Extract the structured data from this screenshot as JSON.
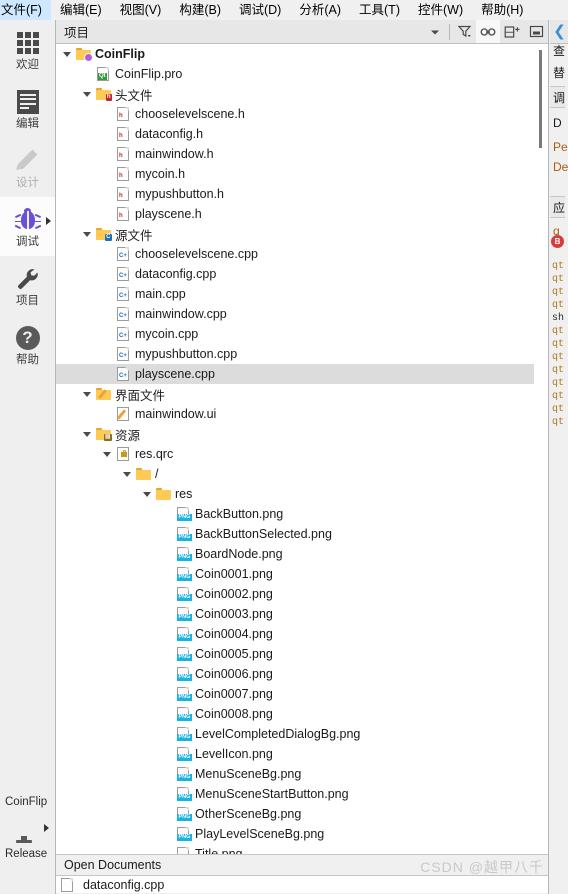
{
  "menubar": {
    "items": [
      {
        "label": "文件(F)",
        "name": "menu-file"
      },
      {
        "label": "编辑(E)",
        "name": "menu-edit"
      },
      {
        "label": "视图(V)",
        "name": "menu-view"
      },
      {
        "label": "构建(B)",
        "name": "menu-build"
      },
      {
        "label": "调试(D)",
        "name": "menu-debug"
      },
      {
        "label": "分析(A)",
        "name": "menu-analyze"
      },
      {
        "label": "工具(T)",
        "name": "menu-tools"
      },
      {
        "label": "控件(W)",
        "name": "menu-window"
      },
      {
        "label": "帮助(H)",
        "name": "menu-help"
      }
    ]
  },
  "modebar": {
    "modes": [
      {
        "label": "欢迎",
        "icon": "grid-icon",
        "state": "normal"
      },
      {
        "label": "编辑",
        "icon": "document-icon",
        "state": "normal"
      },
      {
        "label": "设计",
        "icon": "pencil-icon",
        "state": "disabled"
      },
      {
        "label": "调试",
        "icon": "bug-icon",
        "state": "selected"
      },
      {
        "label": "项目",
        "icon": "wrench-icon",
        "state": "normal"
      },
      {
        "label": "帮助",
        "icon": "question-mark-icon",
        "state": "normal"
      }
    ]
  },
  "kit_selector": {
    "project_name": "CoinFlip",
    "kit_icon": "desktop-monitor-icon",
    "build_config": "Release"
  },
  "nav_header": {
    "title": "项目",
    "buttons": [
      {
        "name": "view-dropdown-button",
        "icon": "chevron-down-icon",
        "active": false
      },
      {
        "name": "filter-button",
        "icon": "filter-funnel-icon",
        "active": false
      },
      {
        "name": "sync-with-editor-button",
        "icon": "link-chain-icon",
        "active": true
      },
      {
        "name": "split-view-button",
        "icon": "split-add-icon",
        "active": false
      },
      {
        "name": "close-pane-button",
        "icon": "minimize-pane-icon",
        "active": false
      }
    ]
  },
  "tree": [
    {
      "label": "CoinFlip",
      "depth": 0,
      "icon": "project-folder-icon",
      "expander": "expanded",
      "bold": true,
      "selected": false
    },
    {
      "label": "CoinFlip.pro",
      "depth": 1,
      "icon": "qt-pro-file-icon",
      "expander": "none",
      "bold": false,
      "selected": false
    },
    {
      "label": "头文件",
      "depth": 1,
      "icon": "header-folder-icon",
      "expander": "expanded",
      "bold": false,
      "selected": false
    },
    {
      "label": "chooselevelscene.h",
      "depth": 2,
      "icon": "header-file-icon",
      "expander": "none",
      "bold": false,
      "selected": false
    },
    {
      "label": "dataconfig.h",
      "depth": 2,
      "icon": "header-file-icon",
      "expander": "none",
      "bold": false,
      "selected": false
    },
    {
      "label": "mainwindow.h",
      "depth": 2,
      "icon": "header-file-icon",
      "expander": "none",
      "bold": false,
      "selected": false
    },
    {
      "label": "mycoin.h",
      "depth": 2,
      "icon": "header-file-icon",
      "expander": "none",
      "bold": false,
      "selected": false
    },
    {
      "label": "mypushbutton.h",
      "depth": 2,
      "icon": "header-file-icon",
      "expander": "none",
      "bold": false,
      "selected": false
    },
    {
      "label": "playscene.h",
      "depth": 2,
      "icon": "header-file-icon",
      "expander": "none",
      "bold": false,
      "selected": false
    },
    {
      "label": "源文件",
      "depth": 1,
      "icon": "source-folder-icon",
      "expander": "expanded",
      "bold": false,
      "selected": false
    },
    {
      "label": "chooselevelscene.cpp",
      "depth": 2,
      "icon": "cpp-file-icon",
      "expander": "none",
      "bold": false,
      "selected": false
    },
    {
      "label": "dataconfig.cpp",
      "depth": 2,
      "icon": "cpp-file-icon",
      "expander": "none",
      "bold": false,
      "selected": false
    },
    {
      "label": "main.cpp",
      "depth": 2,
      "icon": "cpp-file-icon",
      "expander": "none",
      "bold": false,
      "selected": false
    },
    {
      "label": "mainwindow.cpp",
      "depth": 2,
      "icon": "cpp-file-icon",
      "expander": "none",
      "bold": false,
      "selected": false
    },
    {
      "label": "mycoin.cpp",
      "depth": 2,
      "icon": "cpp-file-icon",
      "expander": "none",
      "bold": false,
      "selected": false
    },
    {
      "label": "mypushbutton.cpp",
      "depth": 2,
      "icon": "cpp-file-icon",
      "expander": "none",
      "bold": false,
      "selected": false
    },
    {
      "label": "playscene.cpp",
      "depth": 2,
      "icon": "cpp-file-icon",
      "expander": "none",
      "bold": false,
      "selected": true
    },
    {
      "label": "界面文件",
      "depth": 1,
      "icon": "ui-folder-icon",
      "expander": "expanded",
      "bold": false,
      "selected": false
    },
    {
      "label": "mainwindow.ui",
      "depth": 2,
      "icon": "ui-file-icon",
      "expander": "none",
      "bold": false,
      "selected": false
    },
    {
      "label": "资源",
      "depth": 1,
      "icon": "resource-folder-icon",
      "expander": "expanded",
      "bold": false,
      "selected": false
    },
    {
      "label": "res.qrc",
      "depth": 2,
      "icon": "qrc-file-icon",
      "expander": "expanded",
      "bold": false,
      "selected": false
    },
    {
      "label": "/",
      "depth": 3,
      "icon": "plain-folder-icon",
      "expander": "expanded",
      "bold": false,
      "selected": false
    },
    {
      "label": "res",
      "depth": 4,
      "icon": "plain-folder-icon",
      "expander": "expanded",
      "bold": false,
      "selected": false
    },
    {
      "label": "BackButton.png",
      "depth": 5,
      "icon": "png-file-icon",
      "expander": "none",
      "bold": false,
      "selected": false
    },
    {
      "label": "BackButtonSelected.png",
      "depth": 5,
      "icon": "png-file-icon",
      "expander": "none",
      "bold": false,
      "selected": false
    },
    {
      "label": "BoardNode.png",
      "depth": 5,
      "icon": "png-file-icon",
      "expander": "none",
      "bold": false,
      "selected": false
    },
    {
      "label": "Coin0001.png",
      "depth": 5,
      "icon": "png-file-icon",
      "expander": "none",
      "bold": false,
      "selected": false
    },
    {
      "label": "Coin0002.png",
      "depth": 5,
      "icon": "png-file-icon",
      "expander": "none",
      "bold": false,
      "selected": false
    },
    {
      "label": "Coin0003.png",
      "depth": 5,
      "icon": "png-file-icon",
      "expander": "none",
      "bold": false,
      "selected": false
    },
    {
      "label": "Coin0004.png",
      "depth": 5,
      "icon": "png-file-icon",
      "expander": "none",
      "bold": false,
      "selected": false
    },
    {
      "label": "Coin0005.png",
      "depth": 5,
      "icon": "png-file-icon",
      "expander": "none",
      "bold": false,
      "selected": false
    },
    {
      "label": "Coin0006.png",
      "depth": 5,
      "icon": "png-file-icon",
      "expander": "none",
      "bold": false,
      "selected": false
    },
    {
      "label": "Coin0007.png",
      "depth": 5,
      "icon": "png-file-icon",
      "expander": "none",
      "bold": false,
      "selected": false
    },
    {
      "label": "Coin0008.png",
      "depth": 5,
      "icon": "png-file-icon",
      "expander": "none",
      "bold": false,
      "selected": false
    },
    {
      "label": "LevelCompletedDialogBg.png",
      "depth": 5,
      "icon": "png-file-icon",
      "expander": "none",
      "bold": false,
      "selected": false
    },
    {
      "label": "LevelIcon.png",
      "depth": 5,
      "icon": "png-file-icon",
      "expander": "none",
      "bold": false,
      "selected": false
    },
    {
      "label": "MenuSceneBg.png",
      "depth": 5,
      "icon": "png-file-icon",
      "expander": "none",
      "bold": false,
      "selected": false
    },
    {
      "label": "MenuSceneStartButton.png",
      "depth": 5,
      "icon": "png-file-icon",
      "expander": "none",
      "bold": false,
      "selected": false
    },
    {
      "label": "OtherSceneBg.png",
      "depth": 5,
      "icon": "png-file-icon",
      "expander": "none",
      "bold": false,
      "selected": false
    },
    {
      "label": "PlayLevelSceneBg.png",
      "depth": 5,
      "icon": "png-file-icon",
      "expander": "none",
      "bold": false,
      "selected": false
    },
    {
      "label": "Title.png",
      "depth": 5,
      "icon": "png-file-icon",
      "expander": "none",
      "bold": false,
      "selected": false
    }
  ],
  "open_documents": {
    "title": "Open Documents",
    "items": [
      {
        "label": "dataconfig.cpp",
        "icon": "document-file-icon"
      }
    ]
  },
  "watermark": "CSDN @越甲八千",
  "right_panel": {
    "chevron_icon": "collapse-left-chevron-icon",
    "breakpoint_icon": "breakpoint-marker-icon",
    "breakpoint_label": "B",
    "sections": [
      {
        "text": "查",
        "type": "plain"
      },
      {
        "text": "替",
        "type": "plain"
      },
      {
        "text": "调",
        "type": "header"
      },
      {
        "text": "D",
        "type": "plain"
      },
      {
        "text": "Pe",
        "type": "link"
      },
      {
        "text": "De",
        "type": "link"
      },
      {
        "text": "应",
        "type": "header"
      },
      {
        "text": "q",
        "type": "link"
      }
    ],
    "code_lines": [
      "qt",
      "qt",
      "qt",
      "qt",
      "sh",
      "qt",
      "qt",
      "qt",
      "qt",
      "qt",
      "qt",
      "qt",
      "qt"
    ]
  },
  "colors": {
    "accent_blue": "#3b8fd4",
    "selection_gray": "#dcdcdc",
    "folder_yellow": "#ffca53",
    "png_badge": "#18b4e0",
    "bug_purple": "#6b4fd8",
    "breakpoint_red": "#d93a3a"
  }
}
